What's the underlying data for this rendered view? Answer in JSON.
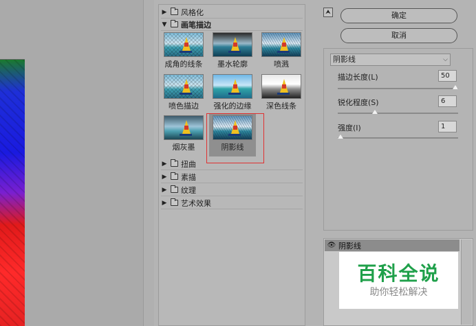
{
  "gallery": {
    "categories": [
      {
        "label": "风格化",
        "expanded": false
      },
      {
        "label": "画笔描边",
        "expanded": true
      },
      {
        "label": "扭曲",
        "expanded": false
      },
      {
        "label": "素描",
        "expanded": false
      },
      {
        "label": "纹理",
        "expanded": false
      },
      {
        "label": "艺术效果",
        "expanded": false
      }
    ],
    "filters": [
      {
        "label": "成角的线条",
        "icon": "angled-strokes-thumbnail"
      },
      {
        "label": "墨水轮廓",
        "icon": "ink-outlines-thumbnail"
      },
      {
        "label": "喷溅",
        "icon": "spatter-thumbnail"
      },
      {
        "label": "喷色描边",
        "icon": "sprayed-strokes-thumbnail"
      },
      {
        "label": "强化的边缘",
        "icon": "accented-edges-thumbnail"
      },
      {
        "label": "深色线条",
        "icon": "dark-strokes-thumbnail"
      },
      {
        "label": "烟灰墨",
        "icon": "sumi-e-thumbnail"
      },
      {
        "label": "阴影线",
        "icon": "crosshatch-thumbnail",
        "selected": true
      }
    ]
  },
  "actions": {
    "ok_label": "确定",
    "cancel_label": "取消",
    "collapse_icon": "collapse-arrows-icon"
  },
  "settings": {
    "filter_name": "阴影线",
    "params": [
      {
        "label": "描边长度(L)",
        "value": "50",
        "fraction": 1.0
      },
      {
        "label": "锐化程度(S)",
        "value": "6",
        "fraction": 0.3
      },
      {
        "label": "强度(I)",
        "value": "1",
        "fraction": 0.0
      }
    ]
  },
  "layers": {
    "items": [
      {
        "label": "阴影线",
        "visible": true
      }
    ]
  },
  "watermark": {
    "title": "百科全说",
    "subtitle": "助你轻松解决"
  }
}
